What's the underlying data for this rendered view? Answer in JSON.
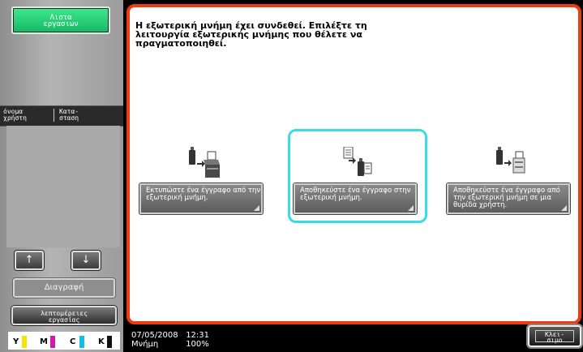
{
  "sidebar": {
    "job_list_line1": "Λιστα",
    "job_list_line2": "εργασιων",
    "tab_username_line1": "όνομα",
    "tab_username_line2": "χρήστη",
    "tab_status_line1": "Κατα-",
    "tab_status_line2": "σταση",
    "up_arrow": "↑",
    "down_arrow": "↓",
    "delete_label": "Διαγραφή",
    "details_line1": "λεπτομέρειες",
    "details_line2": "εργασίας"
  },
  "toner": {
    "labels": [
      "Y",
      "M",
      "C",
      "K"
    ],
    "colors": [
      "#f4e400",
      "#d01aa8",
      "#19b9ea",
      "#111111"
    ]
  },
  "main": {
    "message": "Η εξωτερική μνήμη έχει συνδεθεί. Επιλέξτε τη λειτουργία εξωτερικής μνήμης που θέλετε να πραγματοποιηθεί.",
    "functions": [
      {
        "label": "Εκτυπώστε ένα έγγραφο από την εξωτερική μνήμη.",
        "icon": "usb-to-printer-icon",
        "selected": false
      },
      {
        "label": "Αποθηκεύστε ένα έγγραφο στην εξωτερική μνήμη.",
        "icon": "document-to-usb-icon",
        "selected": true
      },
      {
        "label": "Αποθηκεύστε ένα έγγραφο από την εξωτερική μνήμη σε μια θυρίδα χρήστη.",
        "icon": "usb-to-box-icon",
        "selected": false
      }
    ]
  },
  "status": {
    "date": "07/05/2008",
    "time": "12:31",
    "memory_label": "Μνήμη",
    "memory_value": "100%"
  },
  "close_line1": "Κλει-",
  "close_line2": "σιμο"
}
